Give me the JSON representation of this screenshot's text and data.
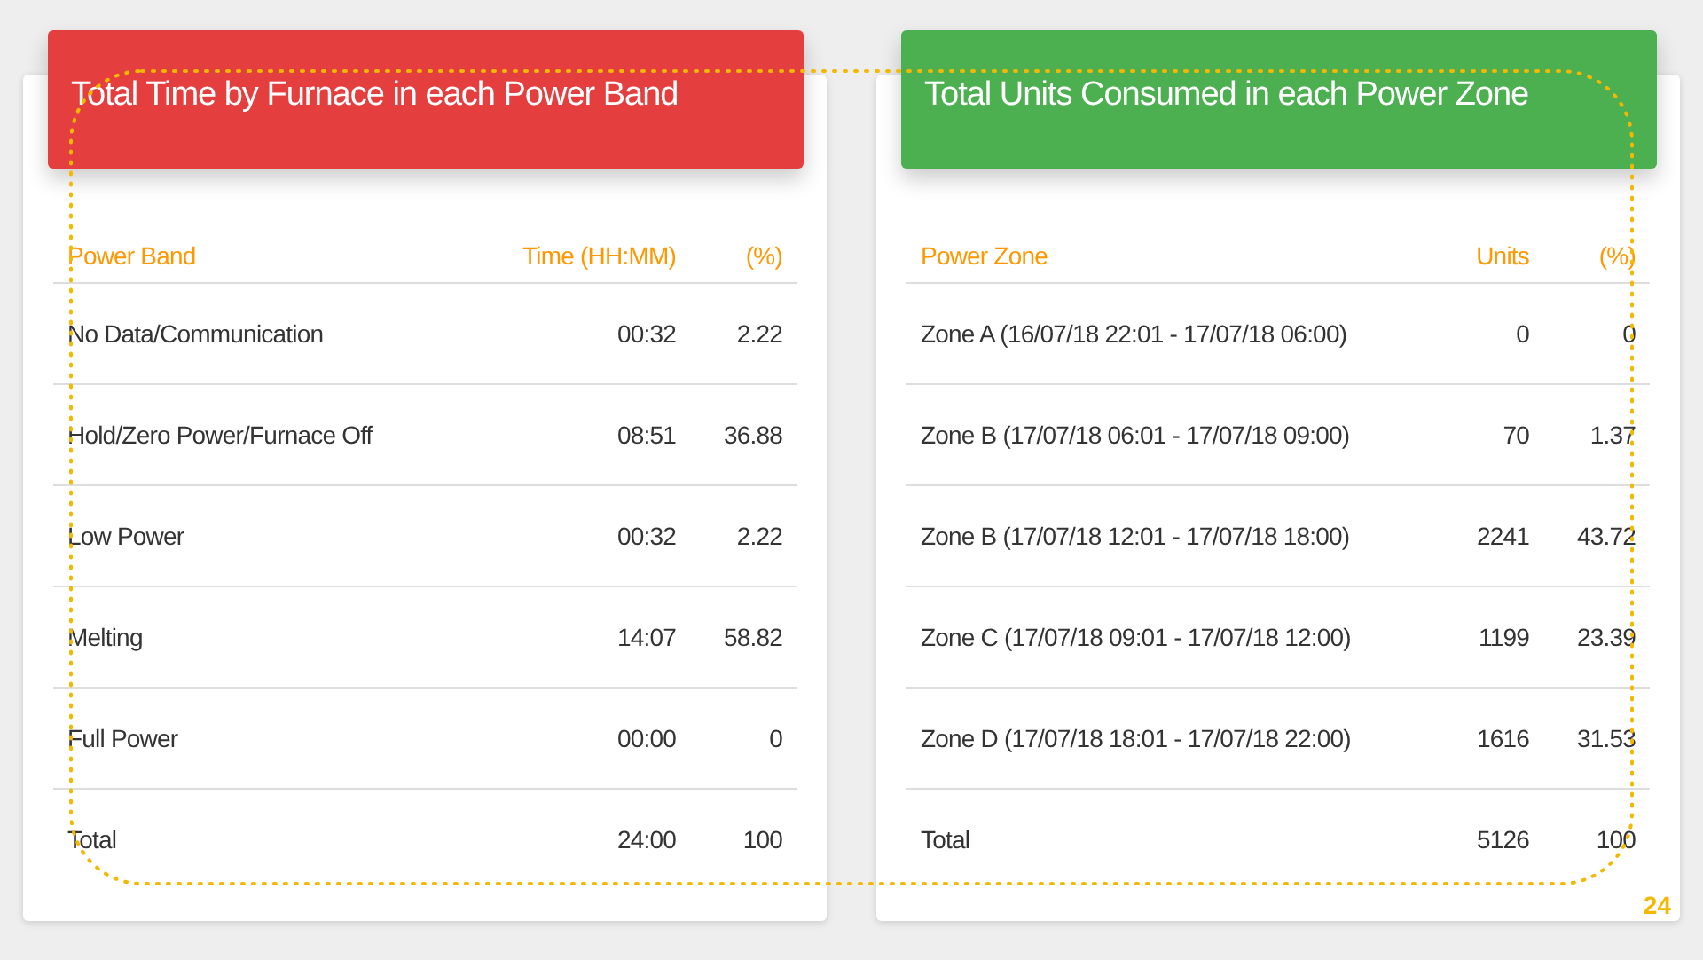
{
  "panels": [
    {
      "title": "Total Time by Furnace in each Power Band",
      "color": "#e53e3e",
      "columns": [
        "Power Band",
        "Time (HH:MM)",
        "(%)"
      ],
      "rows": [
        [
          "No Data/Communication",
          "00:32",
          "2.22"
        ],
        [
          "Hold/Zero Power/Furnace Off",
          "08:51",
          "36.88"
        ],
        [
          "Low Power",
          "00:32",
          "2.22"
        ],
        [
          "Melting",
          "14:07",
          "58.82"
        ],
        [
          "Full Power",
          "00:00",
          "0"
        ],
        [
          "Total",
          "24:00",
          "100"
        ]
      ]
    },
    {
      "title": "Total Units Consumed in each Power Zone",
      "color": "#4caf50",
      "columns": [
        "Power Zone",
        "Units",
        "(%)"
      ],
      "rows": [
        [
          "Zone A (16/07/18 22:01 - 17/07/18 06:00)",
          "0",
          "0"
        ],
        [
          "Zone B (17/07/18 06:01 - 17/07/18 09:00)",
          "70",
          "1.37"
        ],
        [
          "Zone B (17/07/18 12:01 - 17/07/18 18:00)",
          "2241",
          "43.72"
        ],
        [
          "Zone C (17/07/18 09:01 - 17/07/18 12:00)",
          "1199",
          "23.39"
        ],
        [
          "Zone D (17/07/18 18:01 - 17/07/18 22:00)",
          "1616",
          "31.53"
        ],
        [
          "Total",
          "5126",
          "100"
        ]
      ]
    }
  ],
  "page_number": "24"
}
